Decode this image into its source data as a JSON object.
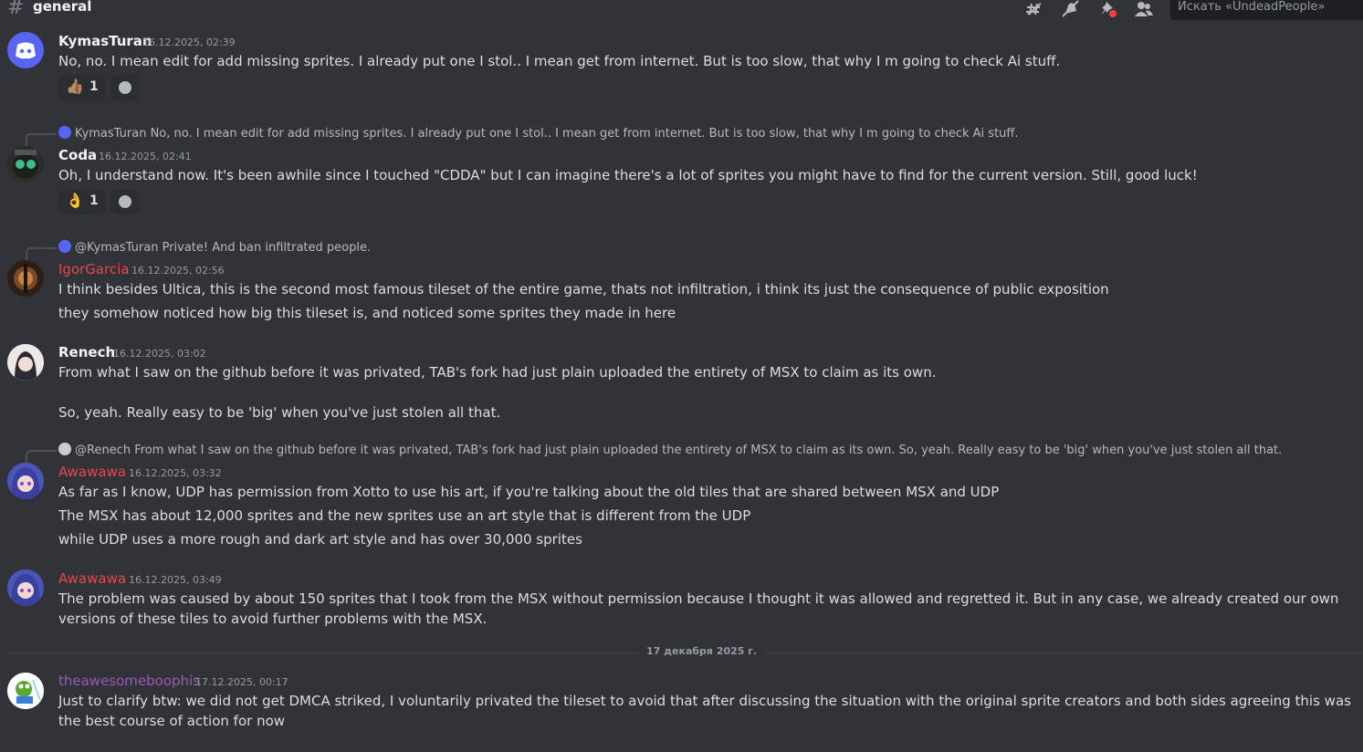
{
  "header": {
    "channel_name": "general",
    "search_placeholder": "Искать «UndeadPeople»",
    "icons": [
      "threads-icon",
      "mute-icon",
      "pinned-icon",
      "members-icon"
    ]
  },
  "colors": {
    "background": "#313338",
    "red_name": "#e5484d",
    "purple_name": "#9b59b6"
  },
  "messages": [
    {
      "author": "KymasTuran",
      "timestamp": "16.12.2025, 02:39",
      "lines": [
        "No, no. I mean edit for add missing sprites. I already put one I stol.. I mean get from internet. But is too slow, that why I m going to check Ai stuff."
      ],
      "reaction": {
        "emoji": "👍🏽",
        "count": "1"
      }
    },
    {
      "reply_author": "KymasTuran",
      "reply_text": "No, no. I mean edit for add missing sprites. I already put one I stol.. I mean get from internet. But is too slow, that why I m going to check Ai stuff.",
      "author": "Coda",
      "timestamp": "16.12.2025, 02:41",
      "lines": [
        "Oh, I understand now. It's been awhile since I touched \"CDDA\" but I can imagine there's a lot of sprites you might have to find for the current version. Still, good luck!"
      ],
      "reaction": {
        "emoji": "👌",
        "count": "1"
      }
    },
    {
      "reply_author": "@KymasTuran",
      "reply_text": "Private! And ban infiltrated people.",
      "author": "IgorGarcia",
      "timestamp": "16.12.2025, 02:56",
      "lines": [
        "I think besides Ultica, this is the second most famous tileset of the entire game, thats not infiltration, i think its just the consequence of public exposition",
        "they somehow noticed how big this tileset is, and noticed some sprites they made in here"
      ]
    },
    {
      "author": "Renech",
      "timestamp": "16.12.2025, 03:02",
      "lines": [
        "From what I saw on the github before it was privated, TAB's fork had just plain uploaded the entirety of MSX to claim as its own.",
        "So, yeah. Really easy to be 'big' when you've just stolen all that."
      ]
    },
    {
      "reply_author": "@Renech",
      "reply_text": "From what I saw on the github before it was privated, TAB's fork had just plain uploaded the entirety of MSX to claim as its own.  So, yeah. Really easy to be 'big' when you've just stolen all that.",
      "author": "Awawawa",
      "timestamp": "16.12.2025, 03:32",
      "lines": [
        "As far as I know, UDP has permission from Xotto to use his art, if you're talking about the old tiles that are shared between MSX and UDP",
        "The MSX has about 12,000 sprites and the new sprites use an art style that is different from the UDP",
        "while UDP uses a more rough and dark art style and has over 30,000 sprites"
      ]
    },
    {
      "author": "Awawawa",
      "timestamp": "16.12.2025, 03:49",
      "lines": [
        "The problem was caused by about 150 sprites that I took from the MSX without permission because I thought it was allowed and regretted it. But in any case, we already created our own versions of these tiles to avoid further problems with the MSX."
      ]
    },
    {
      "author": "theawesomeboophis",
      "timestamp": "17.12.2025, 00:17",
      "lines": [
        "Just to clarify btw: we did not get DMCA striked, I voluntarily privated the tileset to avoid that after discussing the situation with the original sprite creators and both sides agreeing this was the best course of action for now"
      ]
    }
  ],
  "date_divider": "17 декабря 2025 г."
}
